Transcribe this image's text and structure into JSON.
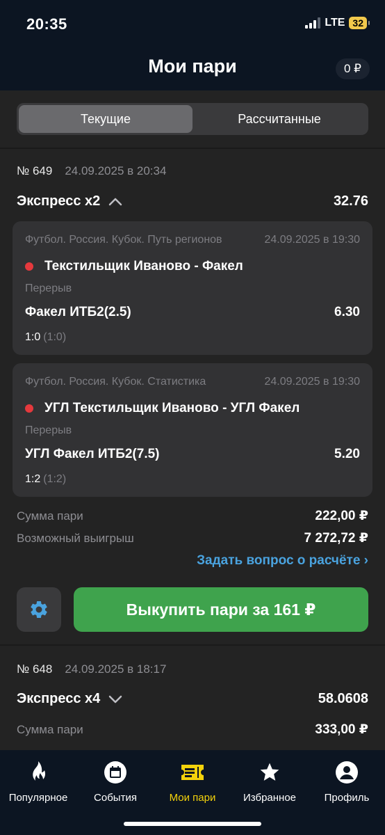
{
  "status_bar": {
    "time": "20:35",
    "network": "LTE",
    "battery": "32"
  },
  "header": {
    "title": "Мои пари",
    "balance": "0 ₽"
  },
  "tabs": [
    {
      "label": "Текущие",
      "active": true
    },
    {
      "label": "Рассчитанные",
      "active": false
    }
  ],
  "bets": [
    {
      "number": "№ 649",
      "datetime": "24.09.2025 в 20:34",
      "type": "Экспресс х2",
      "coef": "32.76",
      "events": [
        {
          "league": "Футбол. Россия. Кубок. Путь регионов",
          "date": "24.09.2025 в 19:30",
          "teams": "Текстильщик Иваново - Факел",
          "status": "Перерыв",
          "market": "Факел ИТБ2(2.5)",
          "odd": "6.30",
          "score": "1:0",
          "score_sub": "(1:0)"
        },
        {
          "league": "Футбол. Россия. Кубок. Статистика",
          "date": "24.09.2025 в 19:30",
          "teams": "УГЛ Текстильщик Иваново - УГЛ Факел",
          "status": "Перерыв",
          "market": "УГЛ Факел ИТБ2(7.5)",
          "odd": "5.20",
          "score": "1:2",
          "score_sub": "(1:2)"
        }
      ],
      "stake_label": "Сумма пари",
      "stake_value": "222,00 ₽",
      "win_label": "Возможный выигрыш",
      "win_value": "7 272,72 ₽",
      "ask_link": "Задать вопрос о расчёте ›",
      "cashout_label": "Выкупить пари за  161 ₽"
    },
    {
      "number": "№ 648",
      "datetime": "24.09.2025 в 18:17",
      "type": "Экспресс х4",
      "coef": "58.0608",
      "stake_label": "Сумма пари",
      "stake_value": "333,00 ₽"
    }
  ],
  "tabbar": [
    {
      "label": "Популярное",
      "icon": "flame-icon"
    },
    {
      "label": "События",
      "icon": "calendar-icon"
    },
    {
      "label": "Мои пари",
      "icon": "ticket-icon",
      "active": true
    },
    {
      "label": "Избранное",
      "icon": "star-icon"
    },
    {
      "label": "Профиль",
      "icon": "profile-icon"
    }
  ],
  "colors": {
    "accent_green": "#3fa34d",
    "active_tab": "#f4d20b",
    "link": "#4aa3df",
    "live": "#e5393d"
  }
}
